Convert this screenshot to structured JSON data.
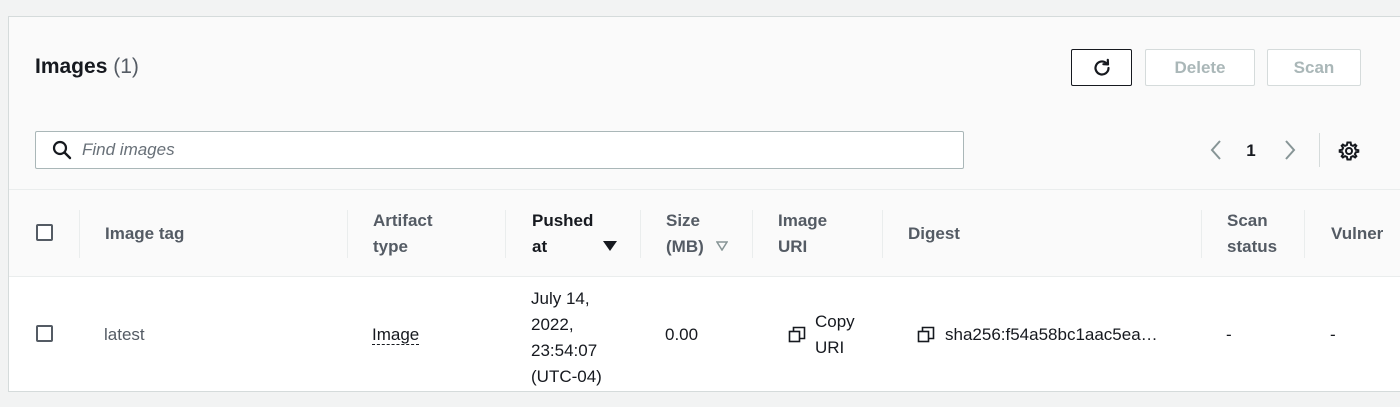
{
  "header": {
    "title": "Images",
    "count": "(1)",
    "refresh_icon": "refresh-icon",
    "delete_label": "Delete",
    "scan_label": "Scan"
  },
  "search": {
    "icon": "search-icon",
    "placeholder": "Find images"
  },
  "pagination": {
    "prev_icon": "chevron-left-icon",
    "current_page": "1",
    "next_icon": "chevron-right-icon",
    "settings_icon": "gear-icon"
  },
  "table": {
    "columns": {
      "image_tag": "Image tag",
      "artifact_type_1": "Artifact",
      "artifact_type_2": "type",
      "pushed_at_1": "Pushed",
      "pushed_at_2": "at",
      "size_1": "Size",
      "size_2": "(MB)",
      "image_uri_1": "Image",
      "image_uri_2": "URI",
      "digest": "Digest",
      "scan_status_1": "Scan",
      "scan_status_2": "status",
      "vulnerabilities": "Vulner"
    },
    "rows": [
      {
        "image_tag": "latest",
        "artifact_type": "Image",
        "pushed_at_1": "July 14,",
        "pushed_at_2": "2022,",
        "pushed_at_3": "23:54:07",
        "pushed_at_4": "(UTC-04)",
        "size": "0.00",
        "image_uri_1": "Copy",
        "image_uri_2": "URI",
        "digest": "sha256:f54a58bc1aac5ea…",
        "scan_status": "-",
        "vulnerabilities": "-"
      }
    ]
  },
  "colors": {
    "page_bg": "#f2f3f3",
    "header_bg": "#fafafa",
    "text": "#16191f",
    "muted": "#545b64",
    "disabled": "#aab7b8"
  }
}
